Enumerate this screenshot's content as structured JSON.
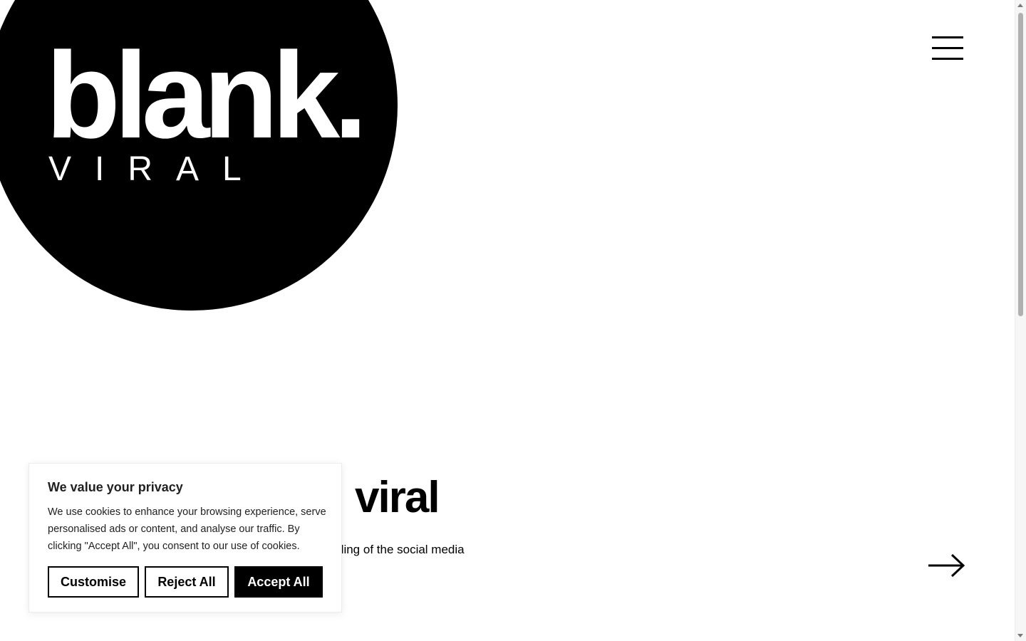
{
  "logo": {
    "main": "blank.",
    "sub": "VIRAL"
  },
  "header": {
    "menu_icon": "hamburger-menu-icon"
  },
  "hero": {
    "title_visible": "viral",
    "text_visible": "ding of the social media",
    "next_icon": "arrow-right-icon"
  },
  "cookie_banner": {
    "title": "We value your privacy",
    "text": "We use cookies to enhance your browsing experience, serve personalised ads or content, and analyse our traffic. By clicking \"Accept All\", you consent to our use of cookies.",
    "customise_label": "Customise",
    "reject_label": "Reject All",
    "accept_label": "Accept All"
  },
  "colors": {
    "brand": "#000000",
    "background": "#ffffff",
    "text": "#212121"
  }
}
